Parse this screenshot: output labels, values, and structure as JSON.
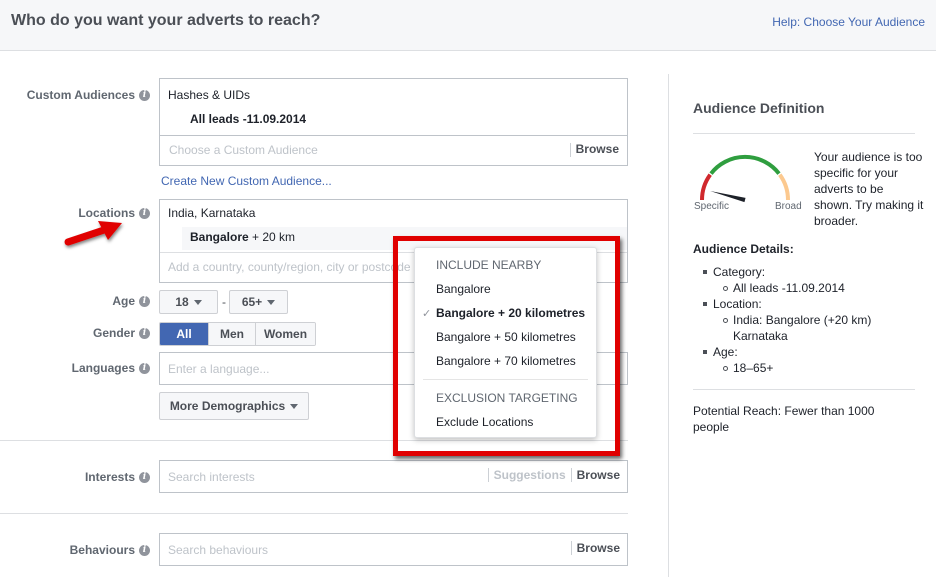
{
  "header": {
    "title": "Who do you want your adverts to reach?",
    "help_link": "Help: Choose Your Audience"
  },
  "form": {
    "custom_audiences": {
      "label": "Custom Audiences",
      "group_name": "Hashes & UIDs",
      "selected": "All leads -11.09.2014",
      "placeholder": "Choose a Custom Audience",
      "browse": "Browse",
      "create_link": "Create New Custom Audience..."
    },
    "locations": {
      "label": "Locations",
      "region": "India, Karnataka",
      "chip_city": "Bangalore",
      "chip_radius": " + 20 km",
      "placeholder": "Add a country, county/region, city or postcode"
    },
    "age": {
      "label": "Age",
      "min": "18",
      "separator": "-",
      "max": "65+"
    },
    "gender": {
      "label": "Gender",
      "options": [
        "All",
        "Men",
        "Women"
      ],
      "selected": "All"
    },
    "languages": {
      "label": "Languages",
      "placeholder": "Enter a language..."
    },
    "more_demographics": "More Demographics",
    "interests": {
      "label": "Interests",
      "placeholder": "Search interests",
      "suggestions": "Suggestions",
      "browse": "Browse"
    },
    "behaviours": {
      "label": "Behaviours",
      "placeholder": "Search behaviours",
      "browse": "Browse"
    }
  },
  "dropdown": {
    "include_heading": "INCLUDE NEARBY",
    "items": [
      "Bangalore",
      "Bangalore + 20 kilometres",
      "Bangalore + 50 kilometres",
      "Bangalore + 70 kilometres"
    ],
    "selected_index": 1,
    "check_glyph": "✓",
    "exclusion_heading": "EXCLUSION TARGETING",
    "exclude_item": "Exclude Locations"
  },
  "audience_definition": {
    "title": "Audience Definition",
    "gauge": {
      "min_label": "Specific",
      "max_label": "Broad",
      "level": 0.08,
      "colors": {
        "low": "#d0282d",
        "mid": "#2f9e3f",
        "high": "#fcc98f",
        "needle": "#1d2129"
      }
    },
    "message": "Your audience is too specific for your adverts to be shown. Try making it broader.",
    "details_title": "Audience Details:",
    "details": [
      {
        "name": "Category:",
        "values": [
          "All leads -11.09.2014"
        ]
      },
      {
        "name": "Location:",
        "values": [
          "India: Bangalore (+20 km) Karnataka"
        ]
      },
      {
        "name": "Age:",
        "values": [
          "18–65+"
        ]
      }
    ],
    "potential_reach": "Potential Reach: Fewer than 1000 people"
  },
  "colors": {
    "brand_blue": "#4267b2",
    "highlight_red": "#e00000"
  }
}
